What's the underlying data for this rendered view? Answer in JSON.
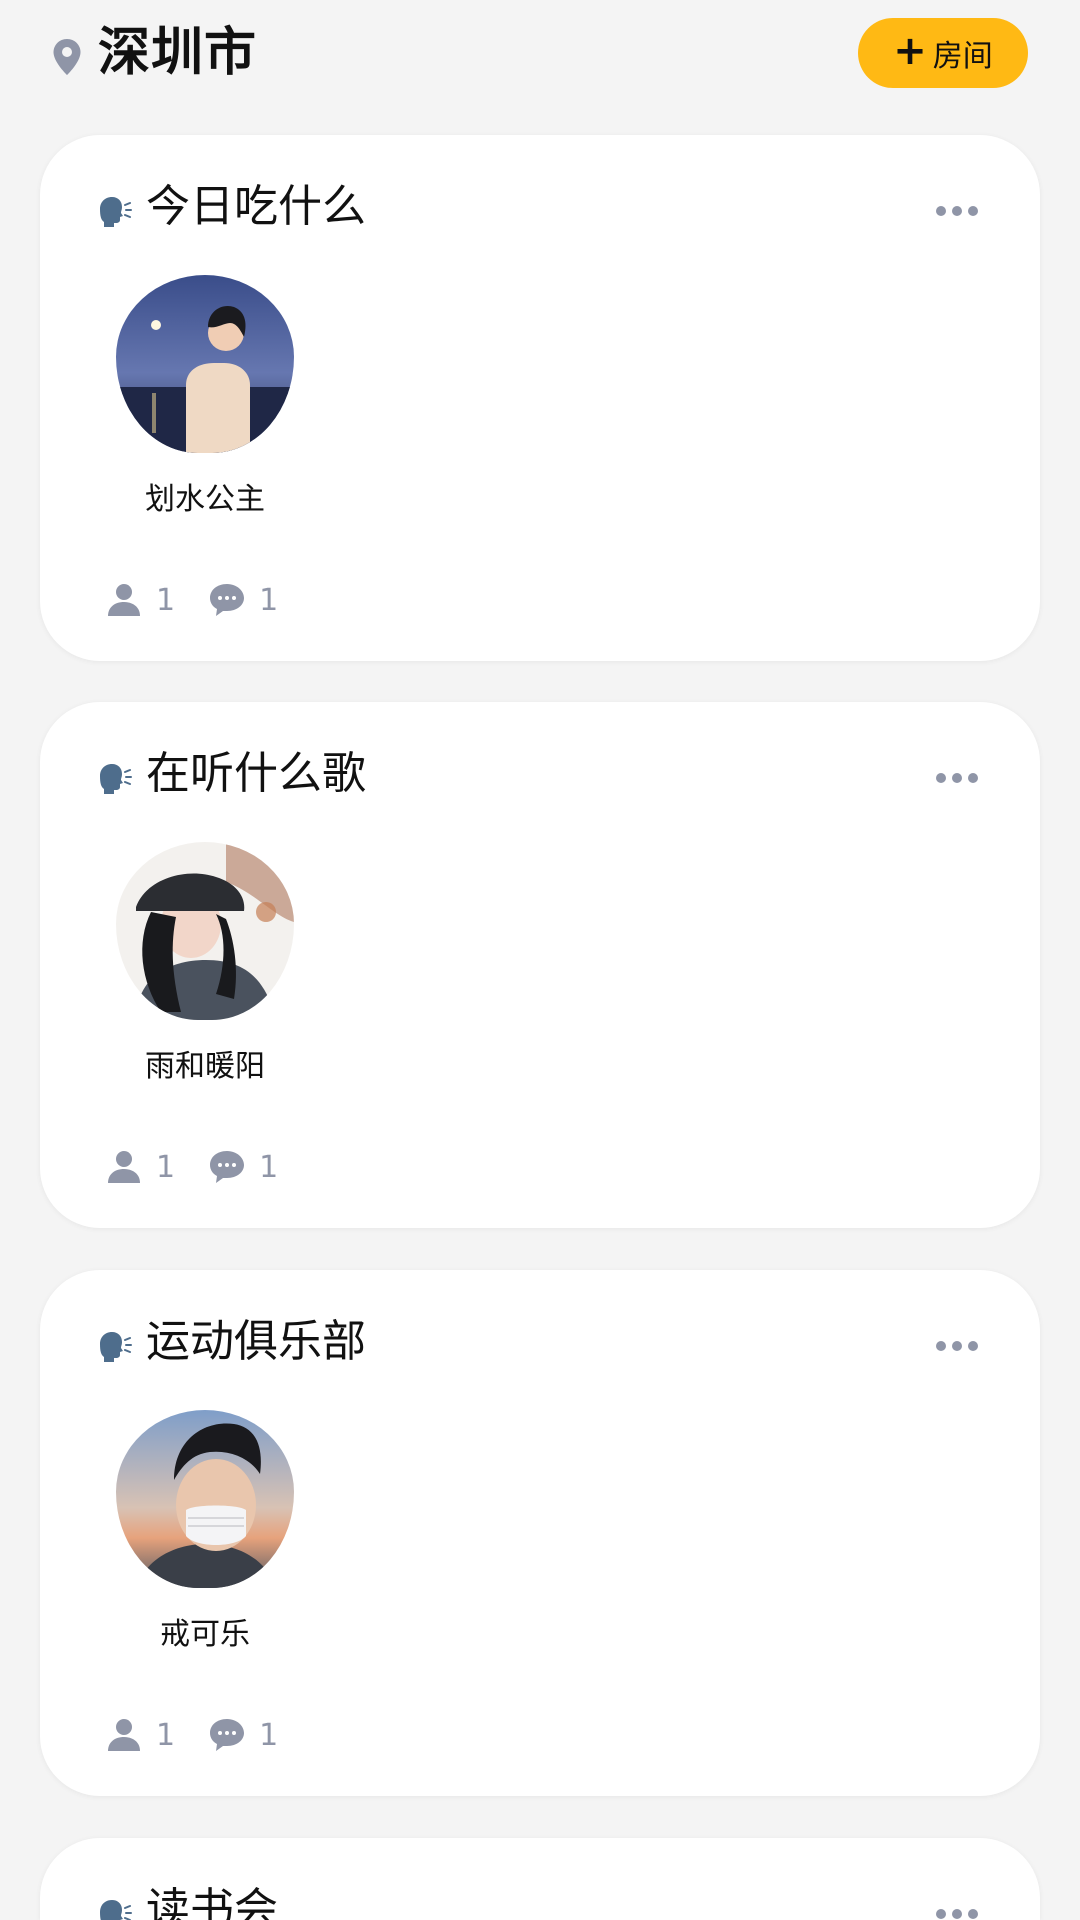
{
  "header": {
    "city": "深圳市",
    "add_room_label": "房间"
  },
  "rooms": [
    {
      "title": "今日吃什么",
      "member": "划水公主",
      "people": "1",
      "messages": "1"
    },
    {
      "title": "在听什么歌",
      "member": "雨和暖阳",
      "people": "1",
      "messages": "1"
    },
    {
      "title": "运动俱乐部",
      "member": "戒可乐",
      "people": "1",
      "messages": "1"
    },
    {
      "title": "读书会"
    }
  ],
  "colors": {
    "accent": "#ffb914",
    "icon_gray": "#8f95a7",
    "background": "#f4f4f4"
  },
  "icons": [
    "location-pin-icon",
    "plus-icon",
    "speaking-head-icon",
    "more-icon",
    "person-icon",
    "chat-bubble-icon"
  ]
}
